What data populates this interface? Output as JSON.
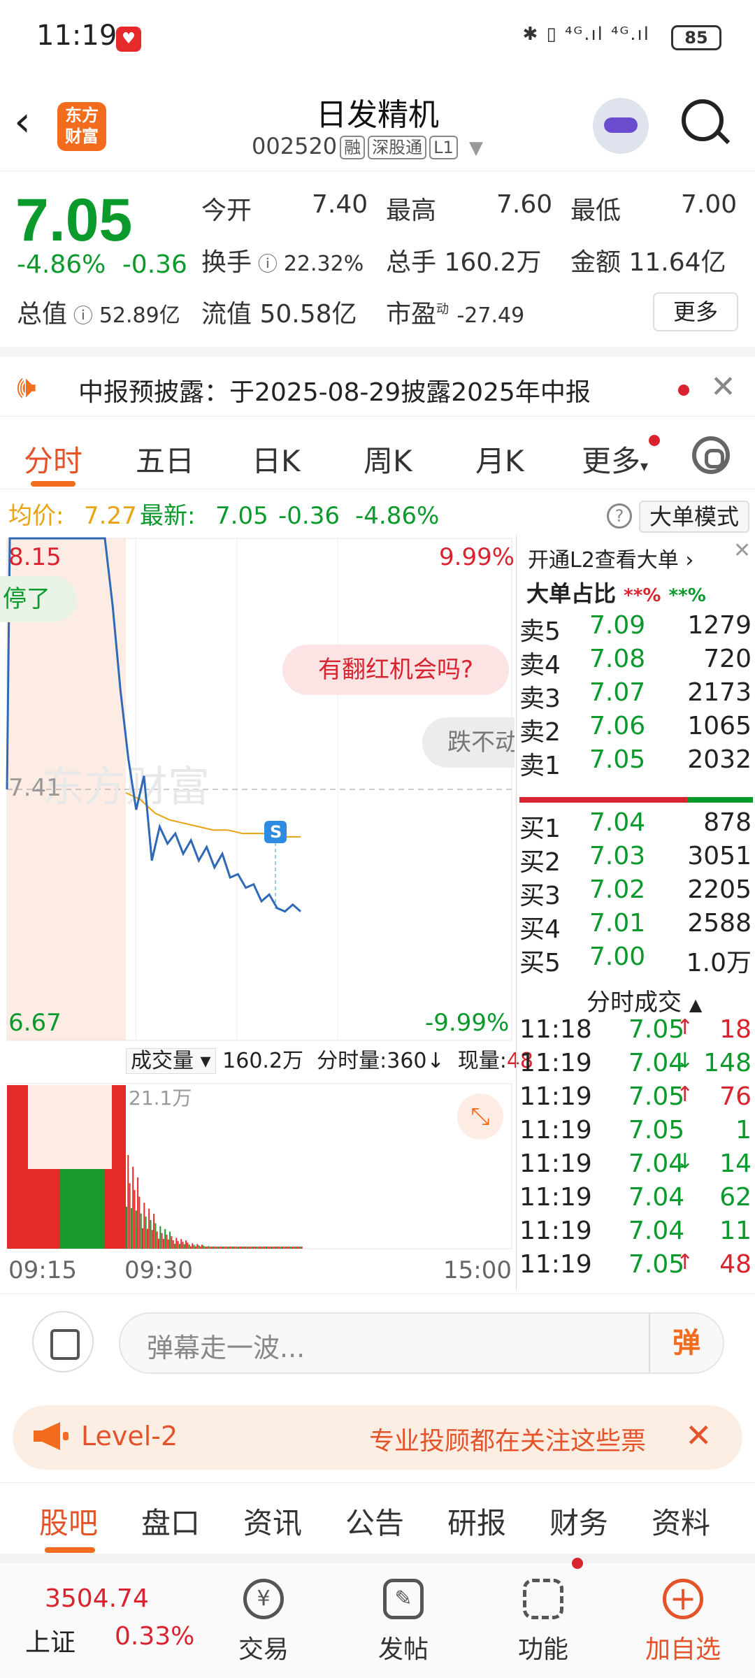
{
  "status_bar": {
    "time": "11:19",
    "battery": "85",
    "signal": "✱ ▯ ⁴ᴳ.ıl ⁴ᴳ.ıl"
  },
  "header": {
    "logo": "东方财富",
    "title": "日发精机",
    "code": "002520",
    "tags": [
      "融",
      "深股通",
      "L1"
    ]
  },
  "quote": {
    "price": "7.05",
    "change_pct": "-4.86%",
    "change_amt": "-0.36",
    "open_label": "今开",
    "open": "7.40",
    "high_label": "最高",
    "high": "7.60",
    "low_label": "最低",
    "low": "7.00",
    "turnover_label": "换手",
    "turnover": "22.32%",
    "volume_label": "总手",
    "volume": "160.2万",
    "amount_label": "金额",
    "amount": "11.64亿",
    "mktcap_label": "总值",
    "mktcap": "52.89亿",
    "float_label": "流值",
    "float": "50.58亿",
    "pe_label": "市盈",
    "pe_sup": "动",
    "pe": "-27.49",
    "more_label": "更多"
  },
  "notice": {
    "text": "中报预披露：于2025-08-29披露2025年中报"
  },
  "tabs": [
    "分时",
    "五日",
    "日K",
    "周K",
    "月K",
    "更多"
  ],
  "avg_bar": {
    "avg_label": "均价:",
    "avg": "7.27",
    "latest_label": "最新:",
    "latest": "7.05",
    "chg": "-0.36",
    "pct": "-4.86%",
    "mode_label": "大单模式"
  },
  "chart_data": {
    "type": "line",
    "y_max_label": "8.15",
    "y_min_label": "6.67",
    "ref_label": "7.41",
    "pct_max_label": "9.99%",
    "pct_min_label": "-9.99%",
    "x_labels": [
      "09:15",
      "09:30",
      "15:00"
    ],
    "ylim": [
      6.67,
      8.15
    ],
    "reference_price": 7.41,
    "price_series": [
      8.15,
      8.15,
      8.15,
      8.15,
      7.95,
      7.7,
      7.5,
      7.35,
      7.45,
      7.2,
      7.3,
      7.25,
      7.28,
      7.22,
      7.26,
      7.2,
      7.24,
      7.18,
      7.22,
      7.15,
      7.16,
      7.12,
      7.13,
      7.08,
      7.1,
      7.06,
      7.05,
      7.07,
      7.05
    ],
    "avg_series": [
      7.4,
      7.38,
      7.34,
      7.32,
      7.31,
      7.3,
      7.29,
      7.29,
      7.28,
      7.28,
      7.28,
      7.27,
      7.27
    ],
    "volume_label": "成交量",
    "volume_total": "160.2万",
    "minute_vol_label": "分时量:360↓",
    "current_vol_label": "现量:",
    "current_vol": "48",
    "vol_max_label": "21.1万",
    "floating_tags": [
      "停了",
      "有翻红机会吗?",
      "跌不动"
    ],
    "s_marker": "S"
  },
  "orderbook": {
    "header": "开通L2查看大单 ›",
    "ratio_label": "大单占比",
    "ratio_red": "**%",
    "ratio_green": "**%",
    "asks": [
      {
        "label": "卖5",
        "price": "7.09",
        "vol": "1279"
      },
      {
        "label": "卖4",
        "price": "7.08",
        "vol": "720"
      },
      {
        "label": "卖3",
        "price": "7.07",
        "vol": "2173"
      },
      {
        "label": "卖2",
        "price": "7.06",
        "vol": "1065"
      },
      {
        "label": "卖1",
        "price": "7.05",
        "vol": "2032"
      }
    ],
    "bids": [
      {
        "label": "买1",
        "price": "7.04",
        "vol": "878"
      },
      {
        "label": "买2",
        "price": "7.03",
        "vol": "3051"
      },
      {
        "label": "买3",
        "price": "7.02",
        "vol": "2205"
      },
      {
        "label": "买4",
        "price": "7.01",
        "vol": "2588"
      },
      {
        "label": "买5",
        "price": "7.00",
        "vol": "1.0万"
      }
    ],
    "ticks_title": "分时成交",
    "ticks": [
      {
        "time": "11:18",
        "price": "7.05",
        "dir": "↑",
        "vol": "18"
      },
      {
        "time": "11:19",
        "price": "7.04",
        "dir": "↓",
        "vol": "148"
      },
      {
        "time": "11:19",
        "price": "7.05",
        "dir": "↑",
        "vol": "76"
      },
      {
        "time": "11:19",
        "price": "7.05",
        "dir": "",
        "vol": "1"
      },
      {
        "time": "11:19",
        "price": "7.04",
        "dir": "↓",
        "vol": "14"
      },
      {
        "time": "11:19",
        "price": "7.04",
        "dir": "",
        "vol": "62"
      },
      {
        "time": "11:19",
        "price": "7.04",
        "dir": "",
        "vol": "11"
      },
      {
        "time": "11:19",
        "price": "7.05",
        "dir": "↑",
        "vol": "48"
      }
    ]
  },
  "danmu": {
    "placeholder": "弹幕走一波...",
    "button": "弹"
  },
  "banner": {
    "left": "Level-2",
    "right": "专业投顾都在关注这些票"
  },
  "subtabs": [
    "股吧",
    "盘口",
    "资讯",
    "公告",
    "研报",
    "财务",
    "资料"
  ],
  "nav": {
    "index_value": "3504.74",
    "index_name": "上证",
    "index_pct": "0.33%",
    "items": [
      "交易",
      "发帖",
      "功能",
      "加自选"
    ]
  },
  "colors": {
    "up": "#d9232e",
    "down": "#0a9a2c",
    "accent": "#f36b1c"
  }
}
